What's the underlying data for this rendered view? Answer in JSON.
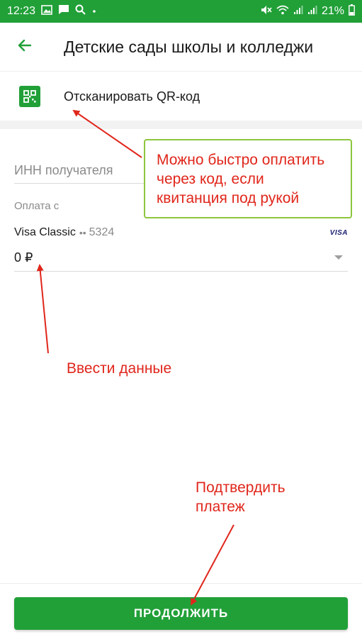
{
  "status_bar": {
    "time": "12:23",
    "battery": "21%"
  },
  "header": {
    "title": "Детские сады школы и колледжи"
  },
  "qr": {
    "label": "Отсканировать QR-код"
  },
  "form": {
    "inn_placeholder": "ИНН получателя",
    "pay_from_label": "Оплата с",
    "card_name": "Visa Classic",
    "card_dots": "••",
    "card_number": "5324",
    "card_brand": "VISA",
    "amount": "0 ₽"
  },
  "actions": {
    "continue_label": "ПРОДОЛЖИТЬ"
  },
  "annotations": {
    "qr_callout": [
      "Можно быстро оплатить",
      "через код, если",
      "квитанция под рукой"
    ],
    "enter_data": "Ввести данные",
    "confirm": [
      "Подтвердить",
      "платеж"
    ]
  },
  "colors": {
    "brand_green": "#21a038",
    "annotation_red": "#e0261b",
    "callout_border": "#8dc63f"
  },
  "icons": [
    "back-arrow-icon",
    "qr-code-icon",
    "dropdown-caret-icon"
  ]
}
